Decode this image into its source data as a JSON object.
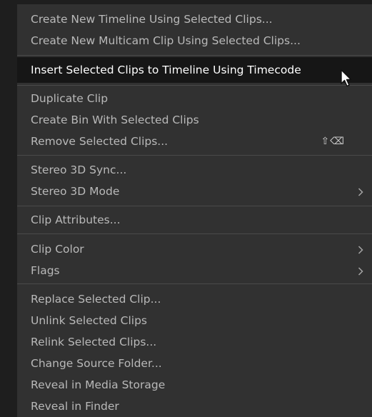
{
  "menu": {
    "groups": [
      {
        "items": [
          {
            "label": "Create New Timeline Using Selected Clips..."
          },
          {
            "label": "Create New Multicam Clip Using Selected Clips..."
          }
        ]
      },
      {
        "items": [
          {
            "label": "Insert Selected Clips to Timeline Using Timecode",
            "highlighted": true
          }
        ]
      },
      {
        "items": [
          {
            "label": "Duplicate Clip"
          },
          {
            "label": "Create Bin With Selected Clips"
          },
          {
            "label": "Remove Selected Clips...",
            "shortcut": "⇧⌫"
          }
        ]
      },
      {
        "items": [
          {
            "label": "Stereo 3D Sync..."
          },
          {
            "label": "Stereo 3D Mode",
            "submenu": true
          }
        ]
      },
      {
        "items": [
          {
            "label": "Clip Attributes..."
          }
        ]
      },
      {
        "items": [
          {
            "label": "Clip Color",
            "submenu": true
          },
          {
            "label": "Flags",
            "submenu": true
          }
        ]
      },
      {
        "items": [
          {
            "label": "Replace Selected Clip..."
          },
          {
            "label": "Unlink Selected Clips"
          },
          {
            "label": "Relink Selected Clips..."
          },
          {
            "label": "Change Source Folder..."
          },
          {
            "label": "Reveal in Media Storage"
          },
          {
            "label": "Reveal in Finder"
          }
        ]
      }
    ]
  },
  "colors": {
    "menu_background": "#313131",
    "highlight_background": "#161616",
    "text": "#b9b9b9",
    "highlight_text": "#ffffff",
    "separator": "#4a4a4a"
  },
  "icons": {
    "submenu": "chevron-right-icon",
    "pointer": "mouse-pointer-icon"
  }
}
